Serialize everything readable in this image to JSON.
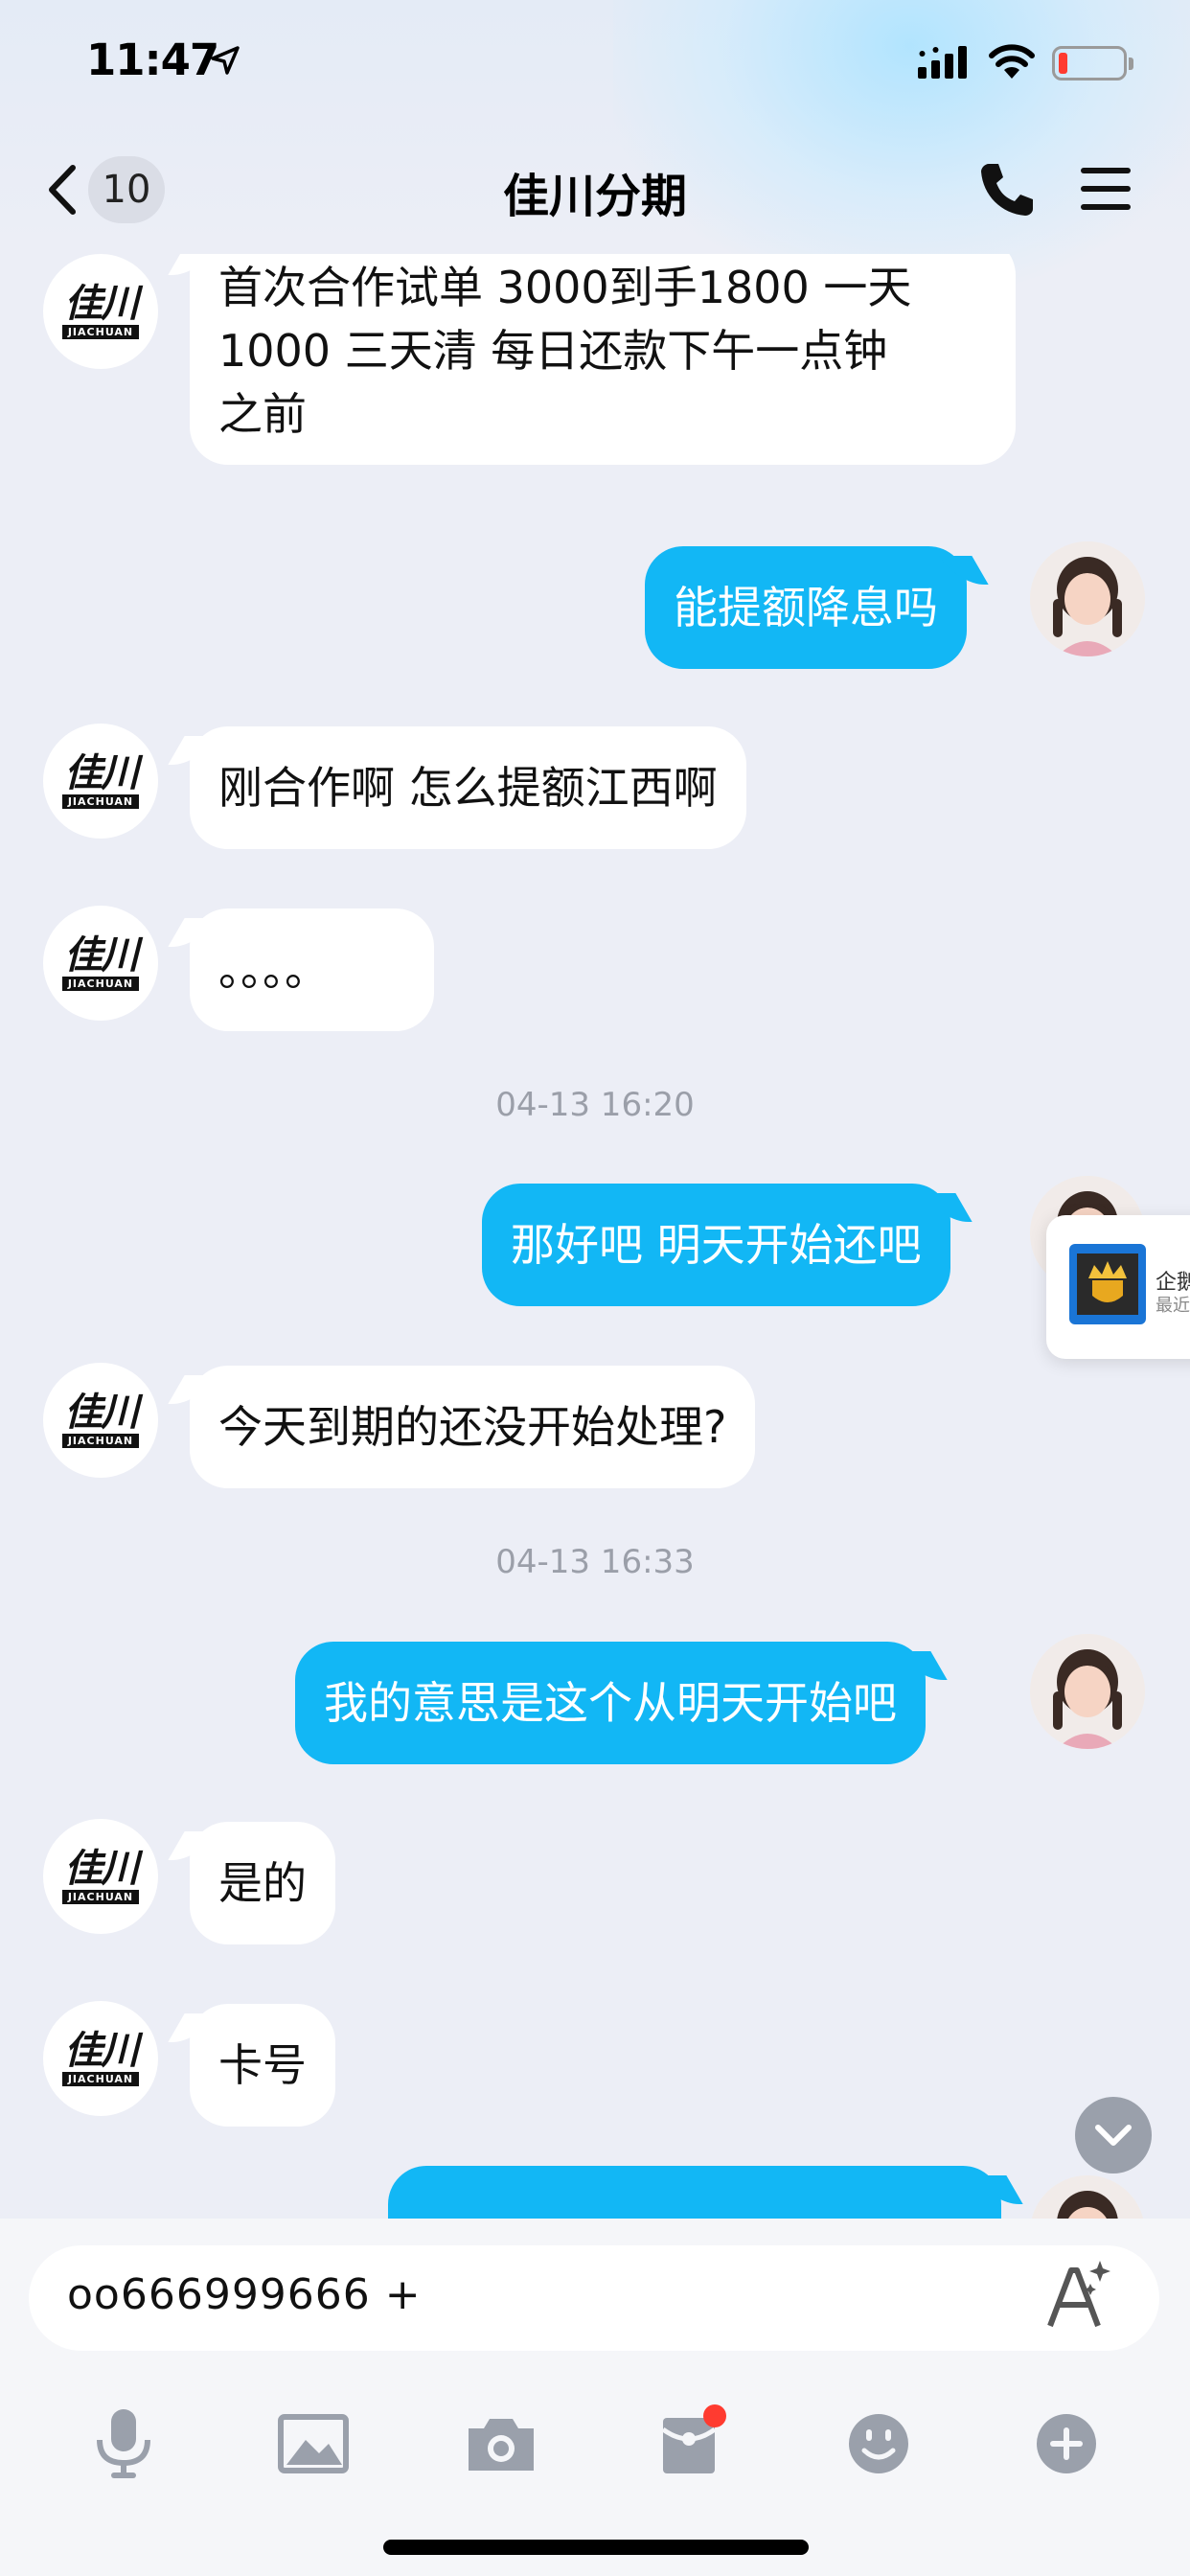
{
  "status_bar": {
    "time": "11:47",
    "battery_level": 0.1
  },
  "nav": {
    "back_count": "10",
    "title": "佳川分期"
  },
  "brand_avatar": {
    "zh": "佳川",
    "en": "JIACHUAN"
  },
  "messages": [
    {
      "side": "in",
      "text_lines": [
        "首次合作试单 3000到手1800 一天",
        "1000 三天清  每日还款下午一点钟",
        "之前"
      ]
    },
    {
      "side": "out",
      "text": "能提额降息吗"
    },
    {
      "side": "in",
      "text": "刚合作啊 怎么提额江西啊"
    },
    {
      "side": "in",
      "text": "。。。。"
    },
    {
      "timestamp": "04-13 16:20"
    },
    {
      "side": "out",
      "text": "那好吧 明天开始还吧"
    },
    {
      "side": "in",
      "text": "今天到期的还没开始处理?"
    },
    {
      "timestamp": "04-13 16:33"
    },
    {
      "side": "out",
      "text": "我的意思是这个从明天开始吧"
    },
    {
      "side": "in",
      "text": "是的"
    },
    {
      "side": "in",
      "text": "卡号"
    }
  ],
  "floating_card": {
    "title": "企鹅",
    "subtitle": "最近"
  },
  "input": {
    "value": "oo666999666 +"
  },
  "toolbar": {
    "items": [
      "mic-icon",
      "image-icon",
      "camera-icon",
      "red-packet-icon",
      "emoji-icon",
      "plus-icon"
    ]
  },
  "colors": {
    "outgoing_bubble": "#12b7f5",
    "incoming_bubble": "#ffffff",
    "background": "#eceef6"
  }
}
